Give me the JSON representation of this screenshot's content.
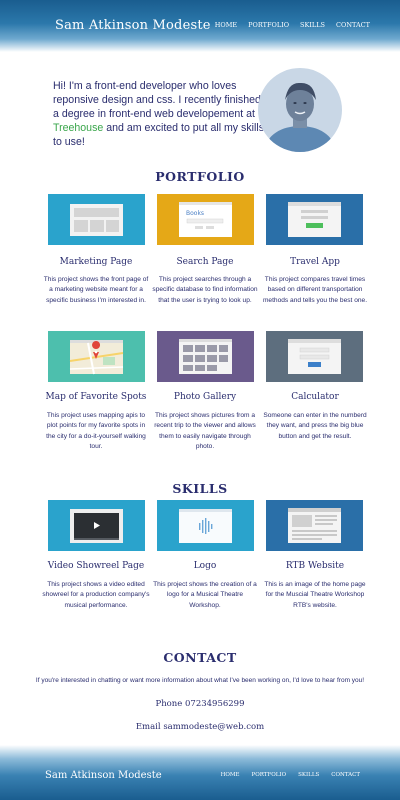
{
  "header": {
    "brand": "Sam Atkinson Modeste",
    "nav": [
      "HOME",
      "PORTFOLIO",
      "SKILLS",
      "CONTACT"
    ]
  },
  "intro": {
    "text_before": "Hi! I'm a front-end developer who loves reponsive design and css. I recently finished a degree in front-end web developement at ",
    "highlight": "Treehouse",
    "text_after": " and am excited to put all my skills to use!"
  },
  "portfolio": {
    "heading": "PORTFOLIO",
    "items": [
      {
        "title": "Marketing Page",
        "desc": "This project shows the front page of a marketing website meant for a specific business I'm interested in.",
        "color": "#2aa3cc",
        "icon": "webpage-thumbnail-icon"
      },
      {
        "title": "Search Page",
        "desc": "This project searches through a specific database to find information that the user is trying to look up.",
        "color": "#e5a817",
        "icon": "search-page-thumbnail-icon",
        "thumb_text": "Books"
      },
      {
        "title": "Travel App",
        "desc": "This project compares travel times based on different transportation methods and tells you the best one.",
        "color": "#2a6fa8",
        "icon": "app-form-thumbnail-icon"
      },
      {
        "title": "Map of Favorite Spots",
        "desc": "This project uses mapping apis to plot points for my favorite spots in the city for a do-it-yourself walking tour.",
        "color": "#4dbfad",
        "icon": "map-pin-thumbnail-icon"
      },
      {
        "title": "Photo Gallery",
        "desc": "This project shows pictures from a recent trip to the viewer and allows them to easily navigate through photo.",
        "color": "#6a5a8c",
        "icon": "photo-gallery-thumbnail-icon"
      },
      {
        "title": "Calculator",
        "desc": "Someone can enter in the numberd they want, and press the big blue button and get the result.",
        "color": "#5d6e7e",
        "icon": "calculator-thumbnail-icon"
      }
    ]
  },
  "skills": {
    "heading": "SKILLS",
    "items": [
      {
        "title": "Video Showreel Page",
        "desc": "This project shows a video edited showreel for a production company's musical performance.",
        "color": "#2aa3cc",
        "icon": "video-player-thumbnail-icon"
      },
      {
        "title": "Logo",
        "desc": "This project shows the creation of a logo for a Musical Theatre Workshop.",
        "color": "#2aa3cc",
        "icon": "logo-thumbnail-icon"
      },
      {
        "title": "RTB Website",
        "desc": "This is an image of the home page for the Muscial Theatre Workshop RTB's website.",
        "color": "#2a6fa8",
        "icon": "website-thumbnail-icon"
      }
    ]
  },
  "contact": {
    "heading": "CONTACT",
    "text": "If you're interested in chatting or want more information about what I've been working on, I'd love to hear from you!",
    "phone": "Phone 07234956299",
    "email": "Email sammodeste@web.com"
  },
  "footer": {
    "brand": "Sam Atkinson Modeste",
    "nav": [
      "HOME",
      "PORTFOLIO",
      "SKILLS",
      "CONTACT"
    ]
  }
}
